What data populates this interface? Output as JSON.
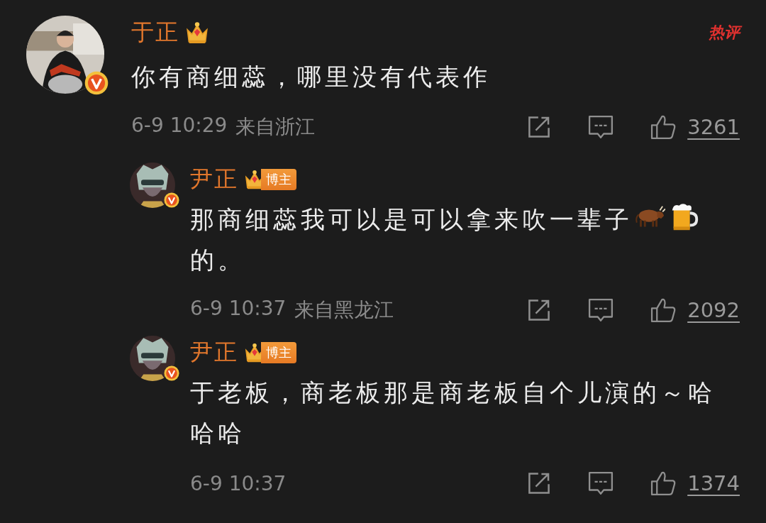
{
  "comments": [
    {
      "kind": "comment",
      "author": "于正",
      "hot_label": "热评",
      "content": [
        {
          "kind": "text",
          "text": "你有商细蕊，哪里没有代表作"
        }
      ],
      "time": "6-9 10:29",
      "location": "来自浙江",
      "likes": "3261"
    },
    {
      "kind": "reply",
      "author": "尹正",
      "role_tag": "博主",
      "content": [
        {
          "kind": "text",
          "text": "那商细蕊我可以是可以拿来吹一辈子"
        },
        {
          "kind": "ox"
        },
        {
          "kind": "beer"
        },
        {
          "kind": "text",
          "text": "的。"
        }
      ],
      "time": "6-9 10:37",
      "location": "来自黑龙江",
      "likes": "2092"
    },
    {
      "kind": "reply",
      "author": "尹正",
      "role_tag": "博主",
      "content": [
        {
          "kind": "text",
          "text": "于老板，商老板那是商老板自个儿演的～哈哈哈"
        }
      ],
      "time": "6-9 10:37",
      "likes": "1374"
    }
  ]
}
